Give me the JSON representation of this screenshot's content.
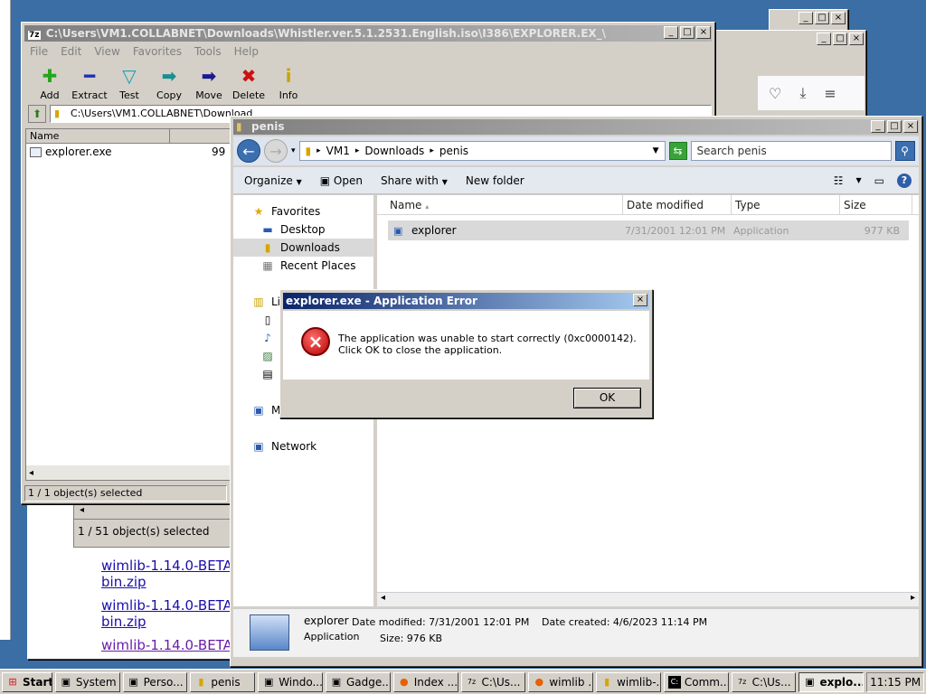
{
  "sevenzip": {
    "title": "C:\\Users\\VM1.COLLABNET\\Downloads\\Whistler.ver.5.1.2531.English.iso\\I386\\EXPLORER.EX_\\",
    "menu": [
      "File",
      "Edit",
      "View",
      "Favorites",
      "Tools",
      "Help"
    ],
    "toolbar": [
      {
        "label": "Add",
        "icon": "plus-icon"
      },
      {
        "label": "Extract",
        "icon": "minus-icon"
      },
      {
        "label": "Test",
        "icon": "check-icon"
      },
      {
        "label": "Copy",
        "icon": "copy-arrow-icon"
      },
      {
        "label": "Move",
        "icon": "move-arrow-icon"
      },
      {
        "label": "Delete",
        "icon": "delete-x-icon"
      },
      {
        "label": "Info",
        "icon": "info-icon"
      }
    ],
    "address": "C:\\Users\\VM1.COLLABNET\\Download",
    "columns": [
      "Name"
    ],
    "file_name": "explorer.exe",
    "file_size_partial": "99",
    "status": "1 / 1 object(s) selected",
    "behind_status": "1 / 51 object(s) selected"
  },
  "explorer": {
    "title": "penis",
    "breadcrumb": [
      "VM1",
      "Downloads",
      "penis"
    ],
    "search_placeholder": "Search penis",
    "commands": [
      "Organize",
      "Open",
      "Share with",
      "New folder"
    ],
    "nav": {
      "favorites": "Favorites",
      "desktop": "Desktop",
      "downloads": "Downloads",
      "recent": "Recent Places",
      "libraries": "Lib",
      "computer": "My",
      "network": "Network"
    },
    "columns": [
      "Name",
      "Date modified",
      "Type",
      "Size"
    ],
    "file": {
      "name": "explorer",
      "date": "7/31/2001 12:01 PM",
      "type": "Application",
      "size": "977 KB"
    },
    "details": {
      "name": "explorer",
      "type": "Application",
      "date_modified_label": "Date modified:",
      "date_modified": "7/31/2001 12:01 PM",
      "date_created_label": "Date created:",
      "date_created": "4/6/2023 11:14 PM",
      "size_label": "Size:",
      "size": "976 KB"
    }
  },
  "error_dialog": {
    "title": "explorer.exe - Application Error",
    "message": "The application was unable to start correctly (0xc0000142). Click OK to close the application.",
    "ok": "OK"
  },
  "browser_links": [
    {
      "line1": "wimlib-1.14.0-BETA",
      "line2": "bin.zip"
    },
    {
      "line1": "wimlib-1.14.0-BETA",
      "line2": "bin.zip"
    },
    {
      "line1": "wimlib-1.14.0-BETA",
      "line2": ""
    }
  ],
  "taskbar": {
    "start": "Start",
    "tasks": [
      {
        "label": "System",
        "icon": "system-icon"
      },
      {
        "label": "Perso...",
        "icon": "personalize-icon"
      },
      {
        "label": "penis",
        "icon": "folder-icon"
      },
      {
        "label": "Windo...",
        "icon": "window-icon"
      },
      {
        "label": "Gadge...",
        "icon": "gadget-icon"
      },
      {
        "label": "Index ...",
        "icon": "firefox-icon"
      },
      {
        "label": "C:\\Us...",
        "icon": "7zip-icon"
      },
      {
        "label": "wimlib ...",
        "icon": "firefox-icon"
      },
      {
        "label": "wimlib-...",
        "icon": "folder-icon"
      },
      {
        "label": "Comm...",
        "icon": "cmd-icon"
      },
      {
        "label": "C:\\Us...",
        "icon": "7zip-icon"
      },
      {
        "label": "explo...",
        "icon": "app-icon"
      }
    ],
    "clock": "11:15 PM"
  },
  "colors": {
    "desktop": "#3a6ea5",
    "error_icon": "#b40000",
    "active_title": "#0a246a"
  }
}
